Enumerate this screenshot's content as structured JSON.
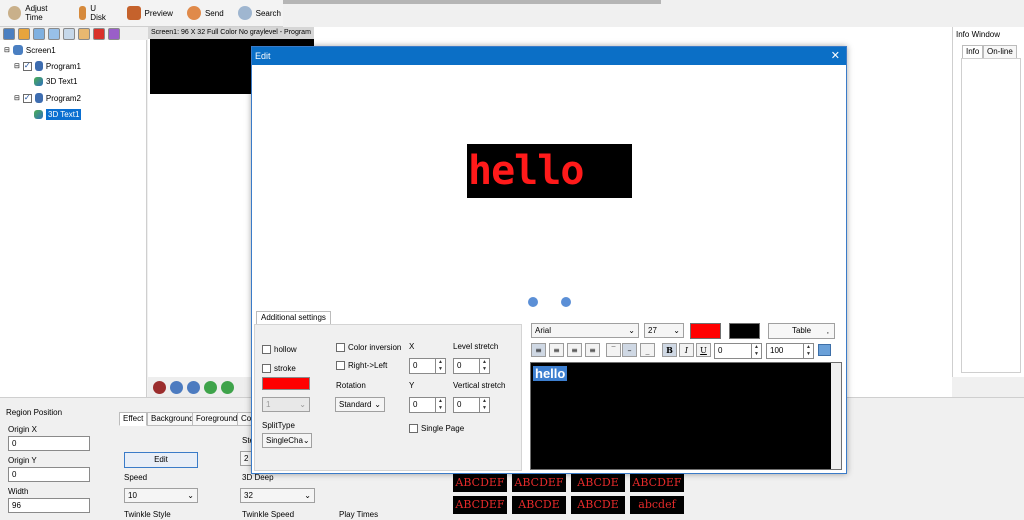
{
  "toolbar": {
    "adjust_time": "Adjust Time",
    "u_disk": "U Disk",
    "preview": "Preview",
    "send": "Send",
    "search": "Search"
  },
  "tree": {
    "screen": "Screen1",
    "program1": "Program1",
    "text1": "3D Text1",
    "program2": "Program2",
    "text2": "3D Text1"
  },
  "screen_title": "Screen1: 96 X 32  Full Color No graylevel - Program",
  "info": {
    "title": "Info Window",
    "tab_info": "Info",
    "tab_online": "On-line"
  },
  "bottom": {
    "region_position": "Region Position",
    "origin_x_label": "Origin X",
    "origin_x": "0",
    "origin_y_label": "Origin Y",
    "origin_y": "0",
    "width_label": "Width",
    "width": "96",
    "tabs": [
      "Effect",
      "Background",
      "Foreground",
      "Colo"
    ],
    "edit_button": "Edit",
    "ste_label": "Ste",
    "ste_value": "2",
    "speed_label": "Speed",
    "speed_value": "10",
    "deep_label": "3D Deep",
    "deep_value": "32",
    "twinkle_style": "Twinkle Style",
    "twinkle_speed": "Twinkle Speed",
    "play_times": "Play Times",
    "thumbs": [
      "ABCDEF",
      "ABCDEF",
      "ABCDE",
      "ABCDEF",
      "ABCDEF",
      "ABCDE",
      "ABCDE",
      "abcdef"
    ]
  },
  "dialog": {
    "title": "Edit",
    "preview_text": "hello",
    "additional_settings": "Additional settings",
    "hollow": "hollow",
    "stroke": "stroke",
    "color_inversion": "Color inversion",
    "right_left": "Right->Left",
    "rotation_label": "Rotation",
    "rotation_value": "Standard",
    "splittype_label": "SplitType",
    "splittype_value": "SingleCha",
    "disabled_value": "1",
    "x_label": "X",
    "x_value": "0",
    "y_label": "Y",
    "y_value": "0",
    "level_stretch_label": "Level stretch",
    "level_stretch_value": "0",
    "vertical_stretch_label": "Vertical stretch",
    "vertical_stretch_value": "0",
    "single_page": "Single Page",
    "font": "Arial",
    "font_size": "27",
    "table_button": "Table",
    "table_chevron": ",",
    "spacing_value": "0",
    "scale_value": "100",
    "bold": "B",
    "italic": "I",
    "underline": "U",
    "editor_text": "hello"
  },
  "colors": {
    "title_blue": "#0b6fc6",
    "led_red": "#ff1a1a",
    "text_color": "#ff0000",
    "background_color": "#000000"
  }
}
